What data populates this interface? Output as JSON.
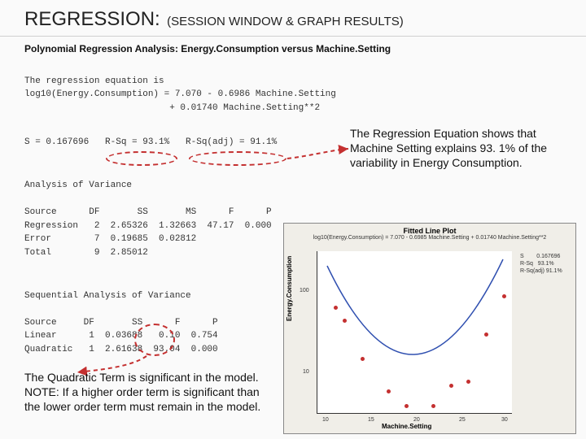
{
  "title": {
    "main": "REGRESSION:",
    "sub": "(SESSION WINDOW & GRAPH RESULTS)"
  },
  "analysis_header": "Polynomial Regression Analysis: Energy.Consumption versus Machine.Setting",
  "equation": {
    "intro": "The regression equation is",
    "line1": "log10(Energy.Consumption) = 7.070 - 0.6986 Machine.Setting",
    "line2": "                           + 0.01740 Machine.Setting**2"
  },
  "stats_line": "S = 0.167696   R-Sq = 93.1%   R-Sq(adj) = 91.1%",
  "anova": {
    "title": "Analysis of Variance",
    "header": "Source      DF       SS       MS      F      P",
    "rows": [
      "Regression   2  2.65326  1.32663  47.17  0.000",
      "Error        7  0.19685  0.02812",
      "Total        9  2.85012"
    ]
  },
  "seq_anova": {
    "title": "Sequential Analysis of Variance",
    "header": "Source     DF       SS      F      P",
    "rows": [
      "Linear      1  0.03688   0.10  0.754",
      "Quadratic   1  2.61638  93.04  0.000"
    ]
  },
  "annotations": {
    "rsq": "The Regression Equation shows that Machine Setting explains 93. 1% of the variability in Energy Consumption.",
    "quadratic": "The Quadratic Term is significant in the model.  NOTE:  If a higher order term is significant than the lower order term must remain in the model."
  },
  "chart_data": {
    "type": "scatter",
    "title": "Fitted Line Plot",
    "subtitle": "log10(Energy.Consumption) = 7.070 - 0.6985 Machine.Setting + 0.01740 Machine.Setting**2",
    "xlabel": "Machine.Setting",
    "ylabel": "Energy.Consumption",
    "legend": {
      "S": "0.167696",
      "R-Sq": "93.1%",
      "R-Sq(adj)": "91.1%"
    },
    "x_ticks": [
      10,
      15,
      20,
      25,
      30
    ],
    "y_ticks": [
      10,
      100
    ],
    "xlim": [
      9,
      31
    ],
    "ylim_log10": [
      0.5,
      2.5
    ],
    "points": [
      {
        "x": 11,
        "y": 65
      },
      {
        "x": 12,
        "y": 45
      },
      {
        "x": 14,
        "y": 15
      },
      {
        "x": 17,
        "y": 6
      },
      {
        "x": 19,
        "y": 4
      },
      {
        "x": 22,
        "y": 4
      },
      {
        "x": 24,
        "y": 7
      },
      {
        "x": 26,
        "y": 8
      },
      {
        "x": 28,
        "y": 30
      },
      {
        "x": 30,
        "y": 90
      }
    ],
    "fit_curve": "quadratic_in_log10",
    "fit_coeffs": {
      "a": 0.0174,
      "b": -0.6986,
      "c": 7.07
    }
  }
}
